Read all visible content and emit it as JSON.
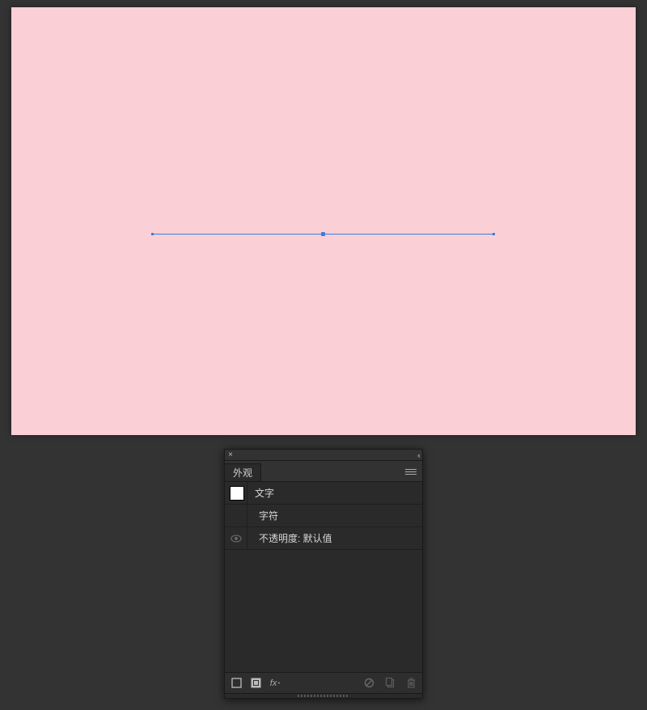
{
  "canvas": {
    "background_color": "#fbcfd6",
    "selection_color": "#3a7ede"
  },
  "panel": {
    "tab_label": "外观",
    "rows": {
      "type_label": "文字",
      "characters_label": "字符",
      "opacity_label": "不透明度: 默认值"
    },
    "icons": {
      "close": "close-icon",
      "collapse": "collapse-arrows-icon",
      "menu": "panel-menu-icon",
      "visibility": "eye-icon",
      "new_stroke": "new-stroke-icon",
      "new_fill": "new-fill-icon",
      "fx": "add-effect-icon",
      "clear": "clear-appearance-icon",
      "duplicate": "duplicate-item-icon",
      "delete": "delete-item-icon"
    }
  }
}
